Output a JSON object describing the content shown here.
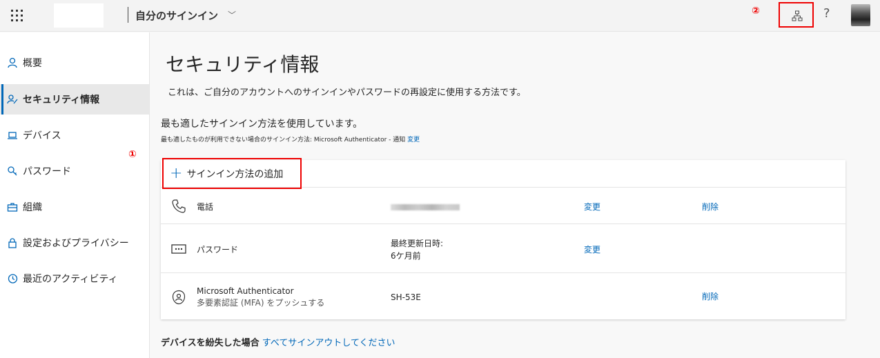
{
  "header": {
    "app_title": "自分のサインイン",
    "marker_2": "②",
    "help_label": "?"
  },
  "sidebar": {
    "marker_1": "①",
    "items": [
      {
        "label": "概要",
        "icon": "person-icon"
      },
      {
        "label": "セキュリティ情報",
        "icon": "security-info-icon",
        "active": true
      },
      {
        "label": "デバイス",
        "icon": "laptop-icon"
      },
      {
        "label": "パスワード",
        "icon": "key-icon"
      },
      {
        "label": "組織",
        "icon": "briefcase-icon"
      },
      {
        "label": "設定およびプライバシー",
        "icon": "lock-icon"
      },
      {
        "label": "最近のアクティビティ",
        "icon": "history-icon"
      }
    ]
  },
  "main": {
    "title": "セキュリティ情報",
    "description": "これは、ご自分のアカウントへのサインインやパスワードの再設定に使用する方法です。",
    "best_method": "最も適したサインイン方法を使用しています。",
    "fallback_text": "最も適したものが利用できない場合のサインイン方法: Microsoft Authenticator - 通知",
    "fallback_change": "変更",
    "add_method": "サインイン方法の追加",
    "methods": [
      {
        "name": "電話",
        "value": "",
        "change": "変更",
        "delete": "削除",
        "icon": "phone-icon"
      },
      {
        "name": "パスワード",
        "value_label": "最終更新日時:",
        "value": "6ケ月前",
        "change": "変更",
        "icon": "password-dots-icon"
      },
      {
        "name": "Microsoft Authenticator",
        "sub": "多要素認証 (MFA) をプッシュする",
        "value": "SH-53E",
        "delete": "削除",
        "icon": "authenticator-icon"
      }
    ],
    "lost_device_label": "デバイスを紛失した場合",
    "lost_device_link": "すべてサインアウトしてください"
  },
  "colors": {
    "accent": "#0067b8",
    "highlight": "#e00000"
  }
}
